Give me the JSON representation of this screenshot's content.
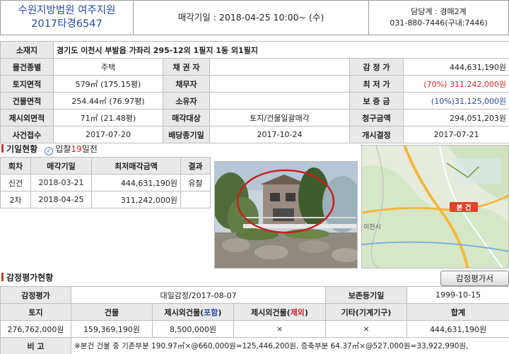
{
  "header": {
    "court": "수원지방법원 여주지원",
    "case_no": "2017타경6547",
    "sale_date": "매각기일 : 2018-04-25   10:00~ (수)",
    "department": "담당계 : 경매2계",
    "phone": "031-880-7446(구내:7446)"
  },
  "info": {
    "address_label": "소재지",
    "address": "경기도 이천시 부발읍 가좌리 295-12외 1필지 1동 외1필지",
    "rows": [
      {
        "l1": "물건종별",
        "v1": "주택",
        "l2": "채 권 자",
        "v2": "",
        "l3": "감 정 가",
        "v3": "444,631,190원"
      },
      {
        "l1": "토지면적",
        "v1": "579㎡ (175.15평)",
        "l2": "채무자",
        "v2": "",
        "l3": "최 저 가",
        "v3": "(70%) 311,242,000원"
      },
      {
        "l1": "건물면적",
        "v1": "254.44㎡ (76.97평)",
        "l2": "소유자",
        "v2": "",
        "l3": "보 증 금",
        "v3": "(10%)31,125,000원"
      },
      {
        "l1": "제시외면적",
        "v1": "71㎡ (21.48평)",
        "l2": "매각대상",
        "v2": "토지/건물일괄매각",
        "l3": "청구금액",
        "v3": "294,051,203원"
      },
      {
        "l1": "사건접수",
        "v1": "2017-07-20",
        "l2": "배당종기일",
        "v2": "2017-10-24",
        "l3": "개시결정",
        "v3": "2017-07-21"
      }
    ]
  },
  "history": {
    "title": "기일현황",
    "badge_prefix": "입찰",
    "badge_days": "19",
    "badge_suffix": "일전",
    "headers": [
      "회차",
      "매각기일",
      "최저매각금액",
      "결과"
    ],
    "rows": [
      {
        "round": "신건",
        "date": "2018-03-21",
        "price": "444,631,190원",
        "result": "유찰"
      },
      {
        "round": "2차",
        "date": "2018-04-25",
        "price": "311,242,000원",
        "result": ""
      }
    ]
  },
  "map": {
    "marker": "본 건",
    "label": "이천시"
  },
  "appraisal": {
    "title": "감정평가현황",
    "button": "감정평가서",
    "row1": {
      "label": "감정평가",
      "value": "대일감정/2017-08-07",
      "label2": "보존등기일",
      "value2": "1999-10-15"
    },
    "headers": [
      "토지",
      "건물",
      "제시외건물(포함)",
      "제시외건물(제외)",
      "기타(기계기구)",
      "합계"
    ],
    "h3_pre": "제시외건물(",
    "h3_hl": "포함",
    "h3_post": ")",
    "h4_pre": "제시외건물(",
    "h4_hl": "제외",
    "h4_post": ")",
    "values": [
      "276,762,000원",
      "159,369,190원",
      "8,500,000원",
      "×",
      "×",
      "444,631,190원"
    ],
    "note_label": "비 고",
    "note": "※본건 건물 중 기존부분 190.97㎡×@660,000원=125,446,200원, 증축부분 64.37㎡×@527,000원=33,922,990원,"
  },
  "colors": {
    "accent_blue": "#2a48a8",
    "accent_red": "#cc2a2a",
    "header_bg": "#e9e9e9"
  }
}
